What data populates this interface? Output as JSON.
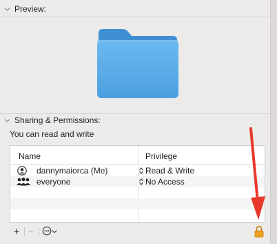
{
  "preview_section": {
    "title": "Preview:"
  },
  "sharing_section": {
    "title": "Sharing & Permissions:",
    "access_text": "You can read and write"
  },
  "table": {
    "headers": {
      "name": "Name",
      "privilege": "Privilege"
    },
    "rows": [
      {
        "name": "dannymaiorca (Me)",
        "privilege": "Read & Write",
        "icon": "user-icon"
      },
      {
        "name": "everyone",
        "privilege": "No Access",
        "icon": "group-icon"
      }
    ]
  },
  "toolbar": {
    "add_label": "+",
    "remove_label": "−",
    "actions_label": "⊖",
    "actions_icon": "ellipsis-circle-icon",
    "lock_icon": "lock-icon"
  },
  "colors": {
    "folder": "#5aa9e6",
    "folder_tab": "#4a9ad8",
    "arrow": "#e8382c",
    "lock": "#f0a020"
  }
}
